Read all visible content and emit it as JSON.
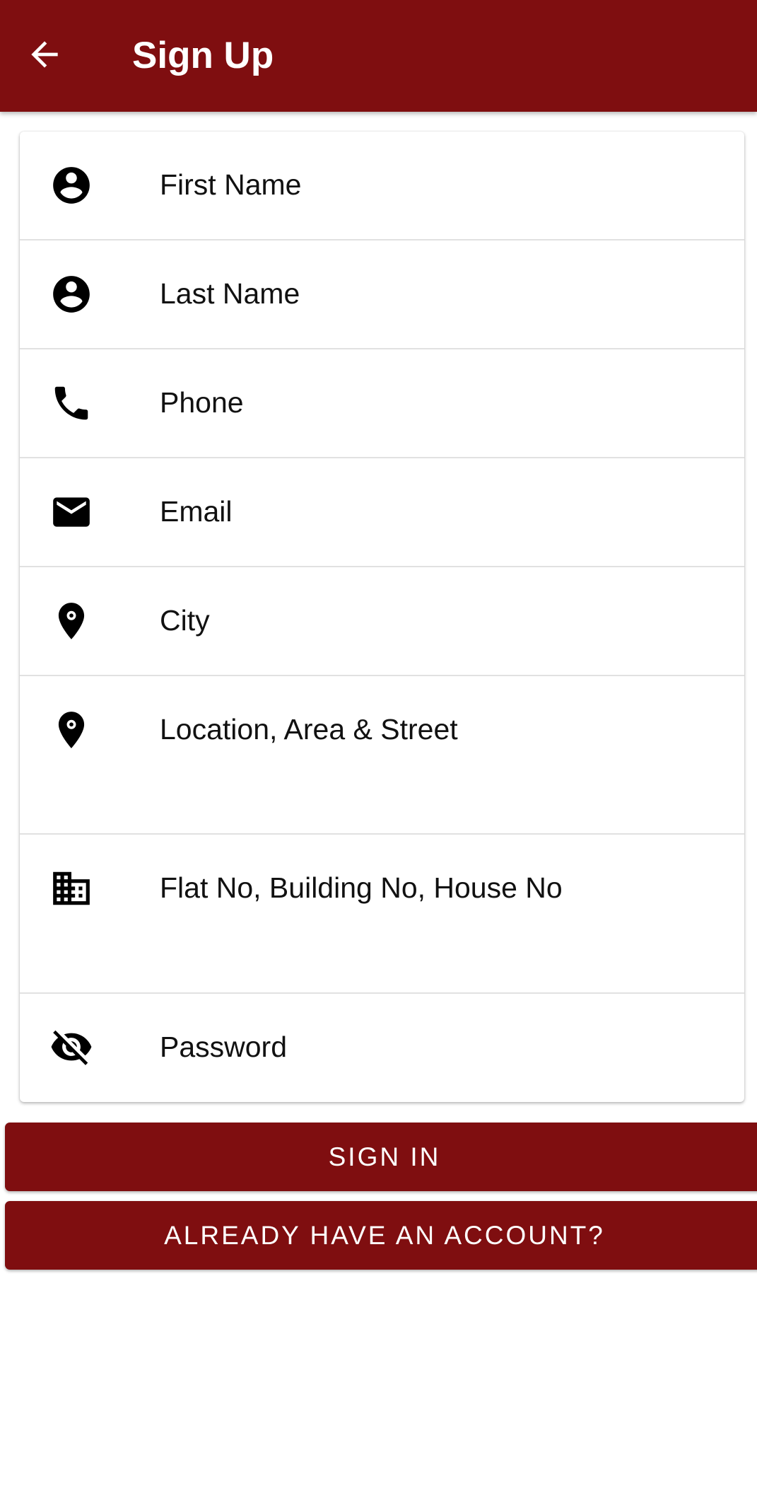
{
  "app_bar": {
    "title": "Sign Up",
    "back_icon": "arrow-left-icon",
    "background": "#7f0e10"
  },
  "form": {
    "fields": [
      {
        "placeholder": "First Name",
        "icon": "account-circle-icon"
      },
      {
        "placeholder": "Last Name",
        "icon": "account-circle-icon"
      },
      {
        "placeholder": "Phone",
        "icon": "phone-icon"
      },
      {
        "placeholder": "Email",
        "icon": "email-icon"
      },
      {
        "placeholder": "City",
        "icon": "location-pin-icon"
      },
      {
        "placeholder": "Location, Area & Street",
        "icon": "location-pin-icon"
      },
      {
        "placeholder": "Flat No, Building No, House No",
        "icon": "building-icon"
      },
      {
        "placeholder": "Password",
        "icon": "eye-off-icon"
      }
    ]
  },
  "buttons": {
    "sign_in": "SIGN IN",
    "already_have_account": "ALREADY HAVE AN ACCOUNT?"
  },
  "colors": {
    "primary": "#7f0e10",
    "on_primary": "#ffffff",
    "divider": "#e1e1e1"
  }
}
